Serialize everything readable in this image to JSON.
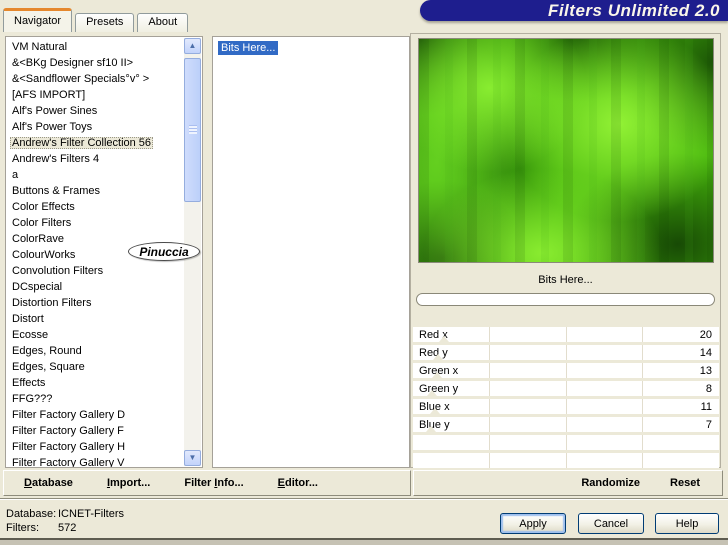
{
  "window": {
    "title": "Filters Unlimited 2.0"
  },
  "tabs": [
    {
      "label": "Navigator",
      "active": true
    },
    {
      "label": "Presets",
      "active": false
    },
    {
      "label": "About",
      "active": false
    }
  ],
  "navigator_list": {
    "selected_index": 6,
    "items": [
      "VM Natural",
      "&<BKg Designer sf10 II>",
      "&<Sandflower Specials°v° >",
      "[AFS IMPORT]",
      "Alf's Power Sines",
      "Alf's Power Toys",
      "Andrew's Filter Collection 56",
      "Andrew's Filters 4",
      "a",
      "Buttons & Frames",
      "Color Effects",
      "Color Filters",
      "ColorRave",
      "ColourWorks",
      "Convolution Filters",
      "DCspecial",
      "Distortion Filters",
      "Distort",
      "Ecosse",
      "Edges, Round",
      "Edges, Square",
      "Effects",
      "FFG???",
      "Filter Factory Gallery D",
      "Filter Factory Gallery F",
      "Filter Factory Gallery H",
      "Filter Factory Gallery V"
    ]
  },
  "filter_list": {
    "selected_index": 0,
    "items": [
      "Bits Here..."
    ]
  },
  "watermark": {
    "text": "Pinuccia"
  },
  "preview": {
    "caption": "Bits Here...",
    "progress_value": 0
  },
  "parameters": {
    "rows": [
      {
        "label": "Red x",
        "value": "20"
      },
      {
        "label": "Red y",
        "value": "14"
      },
      {
        "label": "Green x",
        "value": "13"
      },
      {
        "label": "Green y",
        "value": "8"
      },
      {
        "label": "Blue x",
        "value": "11"
      },
      {
        "label": "Blue y",
        "value": "7"
      },
      {
        "label": "",
        "value": ""
      },
      {
        "label": "",
        "value": ""
      }
    ]
  },
  "left_toolbar": [
    {
      "pre": "",
      "accel": "D",
      "post": "atabase"
    },
    {
      "pre": "",
      "accel": "I",
      "post": "mport..."
    },
    {
      "pre": "Filter ",
      "accel": "I",
      "post": "nfo..."
    },
    {
      "pre": "",
      "accel": "E",
      "post": "ditor..."
    }
  ],
  "right_toolbar": [
    {
      "label": "Randomize"
    },
    {
      "label": "Reset"
    }
  ],
  "status": {
    "database_label": "Database:",
    "database_value": "ICNET-Filters",
    "filters_label": "Filters:",
    "filters_value": "572"
  },
  "dialog_buttons": {
    "apply": "Apply",
    "cancel": "Cancel",
    "help": "Help"
  },
  "icons": {
    "scroll_up": "▲",
    "scroll_down": "▼"
  },
  "colors": {
    "banner_navy": "#1e1e8e",
    "selection_blue": "#316ac5",
    "dialog_beige": "#ece9d8",
    "tab_accent_orange": "#e5872c",
    "preview_base_green": "#46b50c",
    "preview_bright_green": "#8cf032",
    "preview_dark_green": "#164404"
  }
}
